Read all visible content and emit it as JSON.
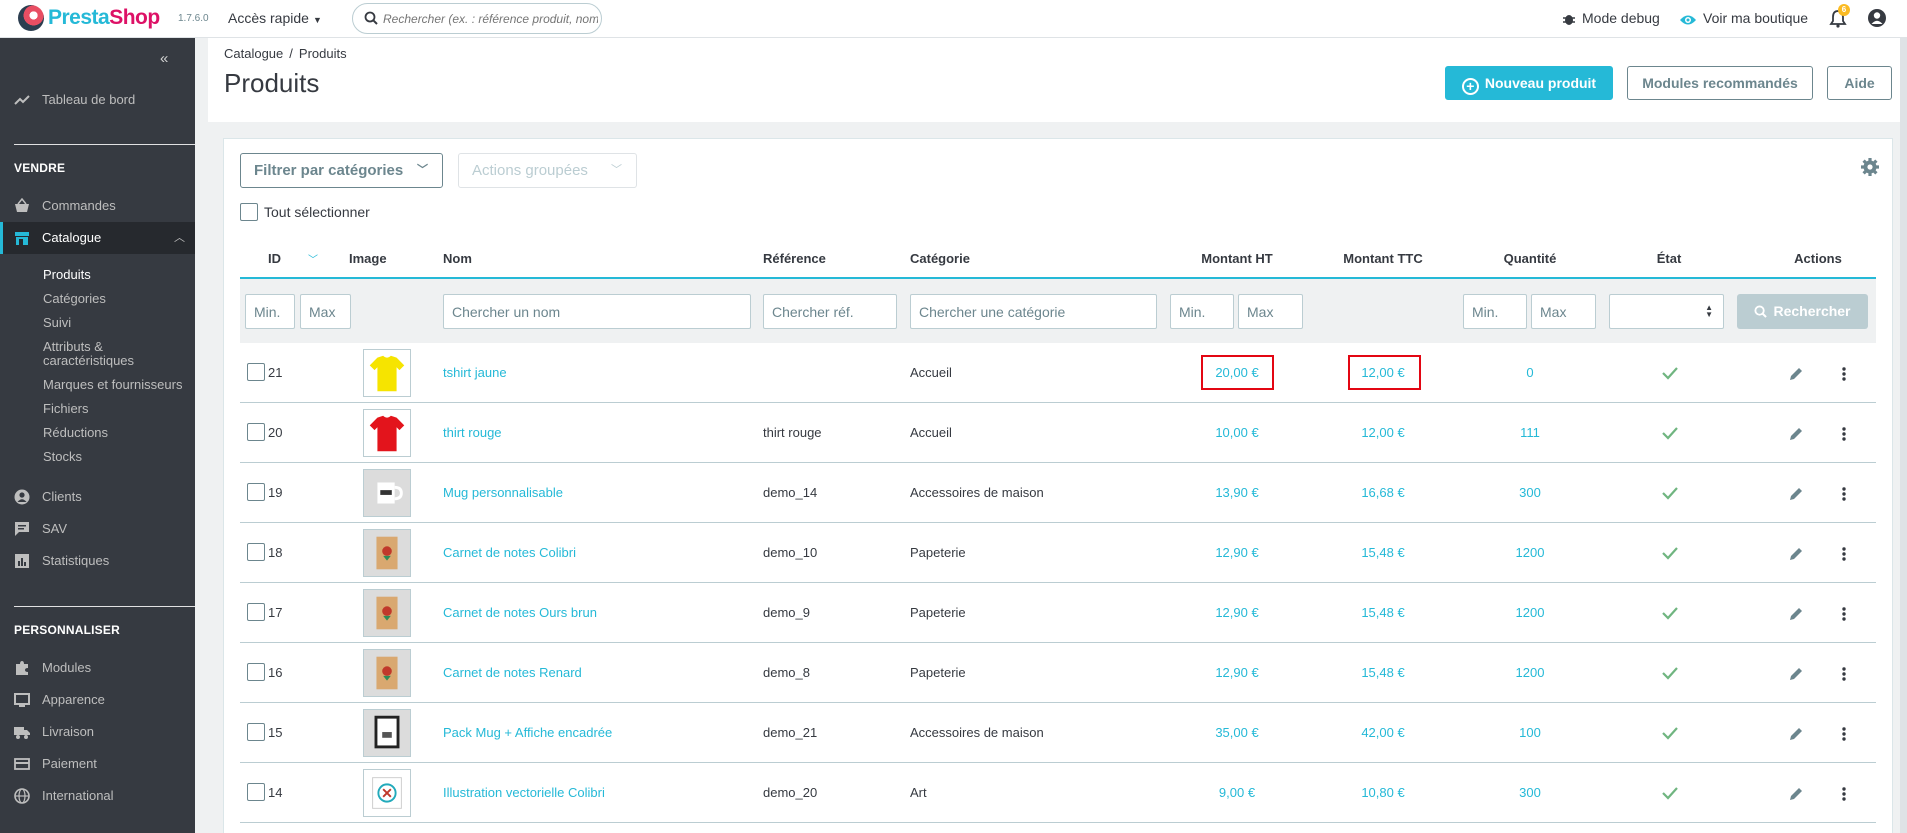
{
  "header": {
    "logo_text_a": "Presta",
    "logo_text_b": "Shop",
    "version": "1.7.6.0",
    "quick_access": "Accès rapide",
    "search_placeholder": "Rechercher (ex. : référence produit, nom",
    "mode_debug": "Mode debug",
    "view_shop": "Voir ma boutique",
    "notifications_count": "6"
  },
  "sidebar": {
    "dashboard": "Tableau de bord",
    "section_sell": "VENDRE",
    "orders": "Commandes",
    "catalog": "Catalogue",
    "catalog_sub": [
      "Produits",
      "Catégories",
      "Suivi",
      "Attributs &",
      "caractéristiques",
      "Marques et fournisseurs",
      "Fichiers",
      "Réductions",
      "Stocks"
    ],
    "customers": "Clients",
    "sav": "SAV",
    "stats": "Statistiques",
    "section_customize": "PERSONNALISER",
    "modules": "Modules",
    "appearance": "Apparence",
    "shipping": "Livraison",
    "payment": "Paiement",
    "international": "International"
  },
  "page": {
    "breadcrumb_root": "Catalogue",
    "breadcrumb_current": "Produits",
    "title": "Produits",
    "btn_new": "Nouveau produit",
    "btn_modules": "Modules recommandés",
    "btn_help": "Aide"
  },
  "toolbar": {
    "filter_categories": "Filtrer par catégories",
    "bulk_actions": "Actions groupées",
    "select_all": "Tout sélectionner"
  },
  "table": {
    "columns": [
      "ID",
      "Image",
      "Nom",
      "Référence",
      "Catégorie",
      "Montant HT",
      "Montant TTC",
      "Quantité",
      "État",
      "Actions"
    ],
    "filters": {
      "min": "Min.",
      "max": "Max",
      "name": "Chercher un nom",
      "ref": "Chercher réf.",
      "category": "Chercher une catégorie",
      "search_button": "Rechercher"
    },
    "rows": [
      {
        "id": "21",
        "name": "tshirt jaune",
        "ref": "",
        "category": "Accueil",
        "price_ht": "20,00 €",
        "price_ttc": "12,00 €",
        "qty": "0",
        "thumb": "yellow-tshirt"
      },
      {
        "id": "20",
        "name": "thirt rouge",
        "ref": "thirt rouge",
        "category": "Accueil",
        "price_ht": "10,00 €",
        "price_ttc": "12,00 €",
        "qty": "111",
        "thumb": "red-tshirt"
      },
      {
        "id": "19",
        "name": "Mug personnalisable",
        "ref": "demo_14",
        "category": "Accessoires de maison",
        "price_ht": "13,90 €",
        "price_ttc": "16,68 €",
        "qty": "300",
        "thumb": "mug"
      },
      {
        "id": "18",
        "name": "Carnet de notes Colibri",
        "ref": "demo_10",
        "category": "Papeterie",
        "price_ht": "12,90 €",
        "price_ttc": "15,48 €",
        "qty": "1200",
        "thumb": "notebook"
      },
      {
        "id": "17",
        "name": "Carnet de notes Ours brun",
        "ref": "demo_9",
        "category": "Papeterie",
        "price_ht": "12,90 €",
        "price_ttc": "15,48 €",
        "qty": "1200",
        "thumb": "notebook"
      },
      {
        "id": "16",
        "name": "Carnet de notes Renard",
        "ref": "demo_8",
        "category": "Papeterie",
        "price_ht": "12,90 €",
        "price_ttc": "15,48 €",
        "qty": "1200",
        "thumb": "notebook"
      },
      {
        "id": "15",
        "name": "Pack Mug + Affiche encadrée",
        "ref": "demo_21",
        "category": "Accessoires de maison",
        "price_ht": "35,00 €",
        "price_ttc": "42,00 €",
        "qty": "100",
        "thumb": "frame"
      },
      {
        "id": "14",
        "name": "Illustration vectorielle Colibri",
        "ref": "demo_20",
        "category": "Art",
        "price_ht": "9,00 €",
        "price_ttc": "10,80 €",
        "qty": "300",
        "thumb": "illustration"
      }
    ]
  },
  "colors": {
    "accent": "#25b9d7",
    "sidebar_bg": "#363a41",
    "success": "#70b580",
    "highlight": "#e30613"
  }
}
